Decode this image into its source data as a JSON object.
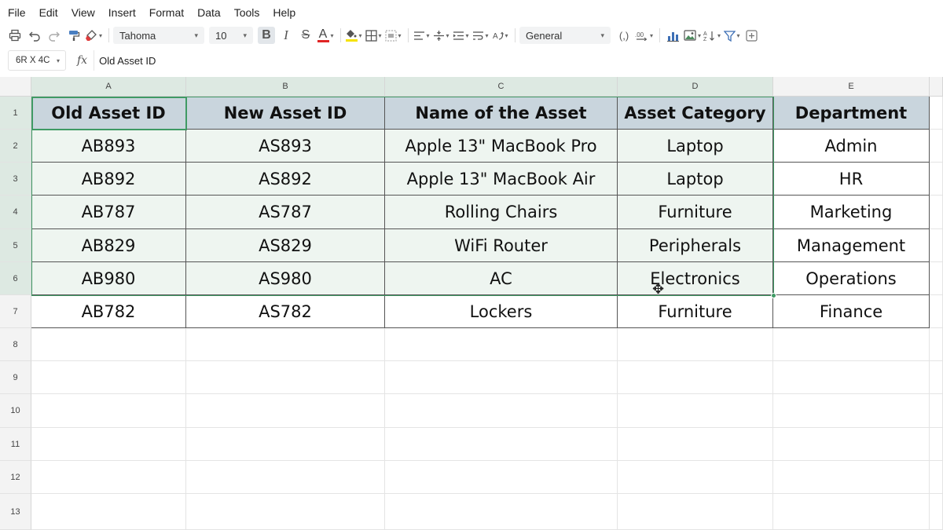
{
  "menu": [
    "File",
    "Edit",
    "View",
    "Insert",
    "Format",
    "Data",
    "Tools",
    "Help"
  ],
  "toolbar": {
    "font_name": "Tahoma",
    "font_size": "10",
    "number_format": "General",
    "bold": "B",
    "italic": "I",
    "strike": "S",
    "font_color": "A",
    "comma": "(,)",
    "font_color_swatch": "#e02424",
    "fill_color_swatch": "#f5e200"
  },
  "formula_bar": {
    "name_box": "6R X 4C",
    "fx_label": "fx",
    "formula": "Old Asset ID"
  },
  "columns": [
    "A",
    "B",
    "C",
    "D",
    "E"
  ],
  "rows": [
    "1",
    "2",
    "3",
    "4",
    "5",
    "6",
    "7",
    "8",
    "9",
    "10",
    "11",
    "12",
    "13"
  ],
  "table": {
    "headers": [
      "Old Asset ID",
      "New Asset ID",
      "Name of the Asset",
      "Asset Category",
      "Department"
    ],
    "rows": [
      [
        "AB893",
        "AS893",
        "Apple 13\" MacBook Pro",
        "Laptop",
        "Admin"
      ],
      [
        "AB892",
        "AS892",
        "Apple 13\" MacBook Air",
        "Laptop",
        "HR"
      ],
      [
        "AB787",
        "AS787",
        "Rolling Chairs",
        "Furniture",
        "Marketing"
      ],
      [
        "AB829",
        "AS829",
        "WiFi Router",
        "Peripherals",
        "Management"
      ],
      [
        "AB980",
        "AS980",
        "AC",
        "Electronics",
        "Operations"
      ],
      [
        "AB782",
        "AS782",
        "Lockers",
        "Furniture",
        "Finance"
      ]
    ]
  },
  "colors": {
    "selection": "#3f9a64",
    "header_fill": "#c9d5dd",
    "range_fill": "#eef5f0"
  }
}
